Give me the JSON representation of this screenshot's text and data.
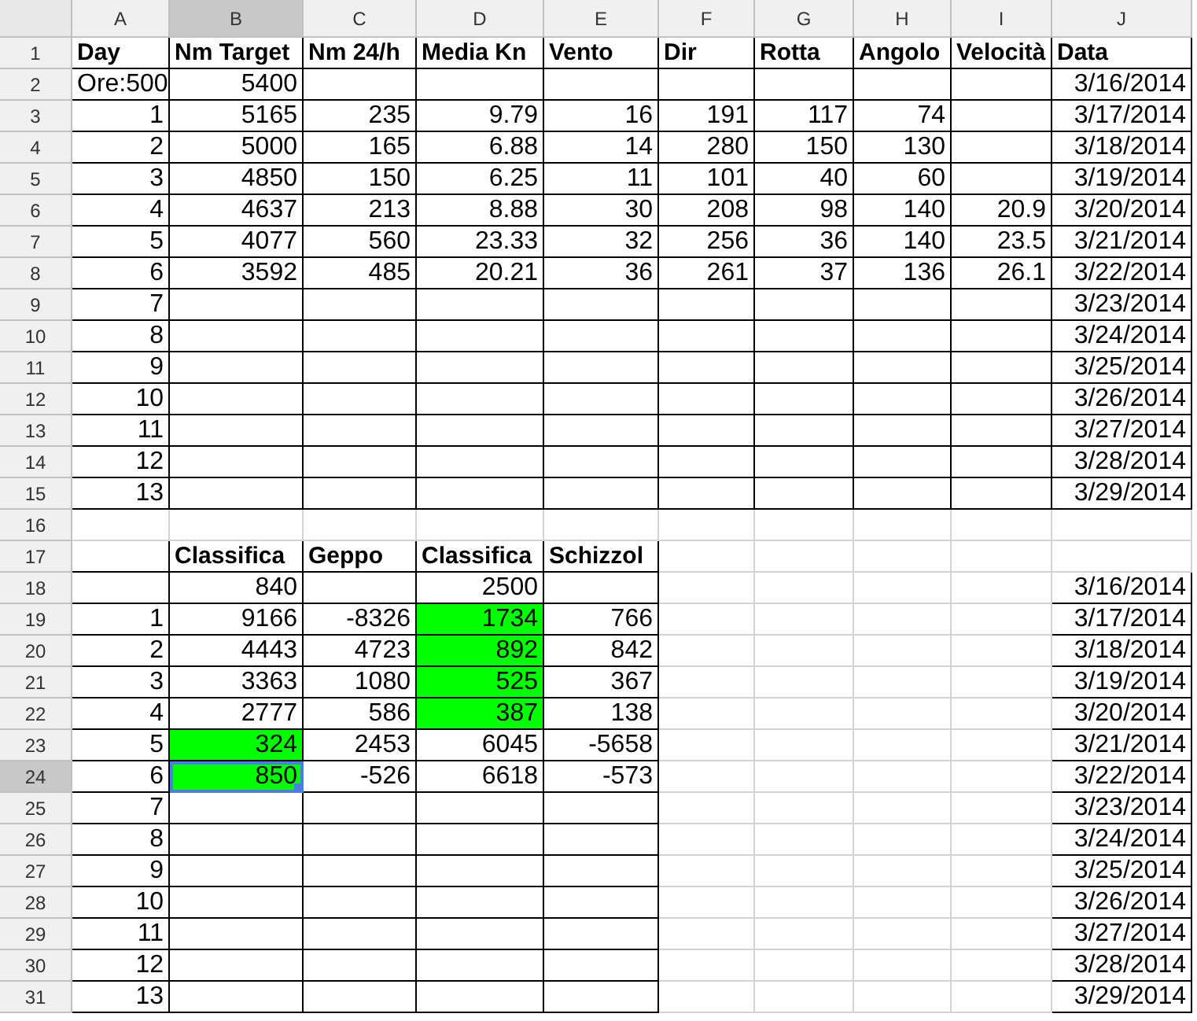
{
  "columns": [
    "A",
    "B",
    "C",
    "D",
    "E",
    "F",
    "G",
    "H",
    "I",
    "J"
  ],
  "rows": [
    {
      "number": "1",
      "cells": {
        "A": {
          "text": "Day",
          "kind": "title"
        },
        "B": {
          "text": "Nm Target",
          "kind": "title"
        },
        "C": {
          "text": "Nm 24/h",
          "kind": "title"
        },
        "D": {
          "text": "Media Kn",
          "kind": "title"
        },
        "E": {
          "text": "Vento",
          "kind": "title"
        },
        "F": {
          "text": "Dir",
          "kind": "title"
        },
        "G": {
          "text": "Rotta",
          "kind": "title"
        },
        "H": {
          "text": "Angolo",
          "kind": "title"
        },
        "I": {
          "text": "Velocità",
          "kind": "title"
        },
        "J": {
          "text": "Data",
          "kind": "title"
        }
      }
    },
    {
      "number": "2",
      "cells": {
        "A": {
          "text": "Ore:500",
          "kind": "text"
        },
        "B": {
          "text": "5400",
          "kind": "number"
        },
        "J": {
          "text": "3/16/2014",
          "kind": "number"
        }
      }
    },
    {
      "number": "3",
      "cells": {
        "A": {
          "text": "1",
          "kind": "number"
        },
        "B": {
          "text": "5165",
          "kind": "number"
        },
        "C": {
          "text": "235",
          "kind": "number"
        },
        "D": {
          "text": "9.79",
          "kind": "number"
        },
        "E": {
          "text": "16",
          "kind": "number"
        },
        "F": {
          "text": "191",
          "kind": "number"
        },
        "G": {
          "text": "117",
          "kind": "number"
        },
        "H": {
          "text": "74",
          "kind": "number"
        },
        "J": {
          "text": "3/17/2014",
          "kind": "number"
        }
      }
    },
    {
      "number": "4",
      "cells": {
        "A": {
          "text": "2",
          "kind": "number"
        },
        "B": {
          "text": "5000",
          "kind": "number"
        },
        "C": {
          "text": "165",
          "kind": "number"
        },
        "D": {
          "text": "6.88",
          "kind": "number"
        },
        "E": {
          "text": "14",
          "kind": "number"
        },
        "F": {
          "text": "280",
          "kind": "number"
        },
        "G": {
          "text": "150",
          "kind": "number"
        },
        "H": {
          "text": "130",
          "kind": "number"
        },
        "J": {
          "text": "3/18/2014",
          "kind": "number"
        }
      }
    },
    {
      "number": "5",
      "cells": {
        "A": {
          "text": "3",
          "kind": "number"
        },
        "B": {
          "text": "4850",
          "kind": "number"
        },
        "C": {
          "text": "150",
          "kind": "number"
        },
        "D": {
          "text": "6.25",
          "kind": "number"
        },
        "E": {
          "text": "11",
          "kind": "number"
        },
        "F": {
          "text": "101",
          "kind": "number"
        },
        "G": {
          "text": "40",
          "kind": "number"
        },
        "H": {
          "text": "60",
          "kind": "number"
        },
        "J": {
          "text": "3/19/2014",
          "kind": "number"
        }
      }
    },
    {
      "number": "6",
      "cells": {
        "A": {
          "text": "4",
          "kind": "number"
        },
        "B": {
          "text": "4637",
          "kind": "number"
        },
        "C": {
          "text": "213",
          "kind": "number"
        },
        "D": {
          "text": "8.88",
          "kind": "number"
        },
        "E": {
          "text": "30",
          "kind": "number"
        },
        "F": {
          "text": "208",
          "kind": "number"
        },
        "G": {
          "text": "98",
          "kind": "number"
        },
        "H": {
          "text": "140",
          "kind": "number"
        },
        "I": {
          "text": "20.9",
          "kind": "number"
        },
        "J": {
          "text": "3/20/2014",
          "kind": "number"
        }
      }
    },
    {
      "number": "7",
      "cells": {
        "A": {
          "text": "5",
          "kind": "number"
        },
        "B": {
          "text": "4077",
          "kind": "number"
        },
        "C": {
          "text": "560",
          "kind": "number"
        },
        "D": {
          "text": "23.33",
          "kind": "number"
        },
        "E": {
          "text": "32",
          "kind": "number"
        },
        "F": {
          "text": "256",
          "kind": "number"
        },
        "G": {
          "text": "36",
          "kind": "number"
        },
        "H": {
          "text": "140",
          "kind": "number"
        },
        "I": {
          "text": "23.5",
          "kind": "number"
        },
        "J": {
          "text": "3/21/2014",
          "kind": "number"
        }
      }
    },
    {
      "number": "8",
      "cells": {
        "A": {
          "text": "6",
          "kind": "number"
        },
        "B": {
          "text": "3592",
          "kind": "number"
        },
        "C": {
          "text": "485",
          "kind": "number"
        },
        "D": {
          "text": "20.21",
          "kind": "number"
        },
        "E": {
          "text": "36",
          "kind": "number"
        },
        "F": {
          "text": "261",
          "kind": "number"
        },
        "G": {
          "text": "37",
          "kind": "number"
        },
        "H": {
          "text": "136",
          "kind": "number"
        },
        "I": {
          "text": "26.1",
          "kind": "number"
        },
        "J": {
          "text": "3/22/2014",
          "kind": "number"
        }
      }
    },
    {
      "number": "9",
      "cells": {
        "A": {
          "text": "7",
          "kind": "number"
        },
        "J": {
          "text": "3/23/2014",
          "kind": "number"
        }
      }
    },
    {
      "number": "10",
      "cells": {
        "A": {
          "text": "8",
          "kind": "number"
        },
        "J": {
          "text": "3/24/2014",
          "kind": "number"
        }
      }
    },
    {
      "number": "11",
      "cells": {
        "A": {
          "text": "9",
          "kind": "number"
        },
        "J": {
          "text": "3/25/2014",
          "kind": "number"
        }
      }
    },
    {
      "number": "12",
      "cells": {
        "A": {
          "text": "10",
          "kind": "number"
        },
        "J": {
          "text": "3/26/2014",
          "kind": "number"
        }
      }
    },
    {
      "number": "13",
      "cells": {
        "A": {
          "text": "11",
          "kind": "number"
        },
        "J": {
          "text": "3/27/2014",
          "kind": "number"
        }
      }
    },
    {
      "number": "14",
      "cells": {
        "A": {
          "text": "12",
          "kind": "number"
        },
        "J": {
          "text": "3/28/2014",
          "kind": "number"
        }
      }
    },
    {
      "number": "15",
      "cells": {
        "A": {
          "text": "13",
          "kind": "number"
        },
        "J": {
          "text": "3/29/2014",
          "kind": "number"
        }
      }
    },
    {
      "number": "16"
    },
    {
      "number": "17",
      "cells": {
        "B": {
          "text": "Classifica",
          "kind": "title"
        },
        "C": {
          "text": "Geppo",
          "kind": "title"
        },
        "D": {
          "text": "Classifica",
          "kind": "title"
        },
        "E": {
          "text": "Schizzol",
          "kind": "title"
        }
      }
    },
    {
      "number": "18",
      "cells": {
        "B": {
          "text": "840",
          "kind": "number"
        },
        "D": {
          "text": "2500",
          "kind": "number"
        },
        "J": {
          "text": "3/16/2014",
          "kind": "number"
        }
      }
    },
    {
      "number": "19",
      "cells": {
        "A": {
          "text": "1",
          "kind": "number"
        },
        "B": {
          "text": "9166",
          "kind": "number"
        },
        "C": {
          "text": "-8326",
          "kind": "number"
        },
        "D": {
          "text": "1734",
          "kind": "number",
          "highlighted": true
        },
        "E": {
          "text": "766",
          "kind": "number"
        },
        "J": {
          "text": "3/17/2014",
          "kind": "number"
        }
      }
    },
    {
      "number": "20",
      "cells": {
        "A": {
          "text": "2",
          "kind": "number"
        },
        "B": {
          "text": "4443",
          "kind": "number"
        },
        "C": {
          "text": "4723",
          "kind": "number"
        },
        "D": {
          "text": "892",
          "kind": "number",
          "highlighted": true
        },
        "E": {
          "text": "842",
          "kind": "number"
        },
        "J": {
          "text": "3/18/2014",
          "kind": "number"
        }
      }
    },
    {
      "number": "21",
      "cells": {
        "A": {
          "text": "3",
          "kind": "number"
        },
        "B": {
          "text": "3363",
          "kind": "number"
        },
        "C": {
          "text": "1080",
          "kind": "number"
        },
        "D": {
          "text": "525",
          "kind": "number",
          "highlighted": true
        },
        "E": {
          "text": "367",
          "kind": "number"
        },
        "J": {
          "text": "3/19/2014",
          "kind": "number"
        }
      }
    },
    {
      "number": "22",
      "cells": {
        "A": {
          "text": "4",
          "kind": "number"
        },
        "B": {
          "text": "2777",
          "kind": "number"
        },
        "C": {
          "text": "586",
          "kind": "number"
        },
        "D": {
          "text": "387",
          "kind": "number",
          "highlighted": true
        },
        "E": {
          "text": "138",
          "kind": "number"
        },
        "J": {
          "text": "3/20/2014",
          "kind": "number"
        }
      }
    },
    {
      "number": "23",
      "cells": {
        "A": {
          "text": "5",
          "kind": "number"
        },
        "B": {
          "text": "324",
          "kind": "number",
          "highlighted": true
        },
        "C": {
          "text": "2453",
          "kind": "number"
        },
        "D": {
          "text": "6045",
          "kind": "number"
        },
        "E": {
          "text": "-5658",
          "kind": "number"
        },
        "J": {
          "text": "3/21/2014",
          "kind": "number"
        }
      }
    },
    {
      "number": "24",
      "cells": {
        "A": {
          "text": "6",
          "kind": "number"
        },
        "B": {
          "text": "850",
          "kind": "number",
          "highlighted": true,
          "selected": true
        },
        "C": {
          "text": "-526",
          "kind": "number"
        },
        "D": {
          "text": "6618",
          "kind": "number"
        },
        "E": {
          "text": "-573",
          "kind": "number"
        },
        "J": {
          "text": "3/22/2014",
          "kind": "number"
        }
      }
    },
    {
      "number": "25",
      "cells": {
        "A": {
          "text": "7",
          "kind": "number"
        },
        "J": {
          "text": "3/23/2014",
          "kind": "number"
        }
      }
    },
    {
      "number": "26",
      "cells": {
        "A": {
          "text": "8",
          "kind": "number"
        },
        "J": {
          "text": "3/24/2014",
          "kind": "number"
        }
      }
    },
    {
      "number": "27",
      "cells": {
        "A": {
          "text": "9",
          "kind": "number"
        },
        "J": {
          "text": "3/25/2014",
          "kind": "number"
        }
      }
    },
    {
      "number": "28",
      "cells": {
        "A": {
          "text": "10",
          "kind": "number"
        },
        "J": {
          "text": "3/26/2014",
          "kind": "number"
        }
      }
    },
    {
      "number": "29",
      "cells": {
        "A": {
          "text": "11",
          "kind": "number"
        },
        "J": {
          "text": "3/27/2014",
          "kind": "number"
        }
      }
    },
    {
      "number": "30",
      "cells": {
        "A": {
          "text": "12",
          "kind": "number"
        },
        "J": {
          "text": "3/28/2014",
          "kind": "number"
        }
      }
    },
    {
      "number": "31",
      "cells": {
        "A": {
          "text": "13",
          "kind": "number"
        },
        "J": {
          "text": "3/29/2014",
          "kind": "number"
        }
      }
    }
  ]
}
